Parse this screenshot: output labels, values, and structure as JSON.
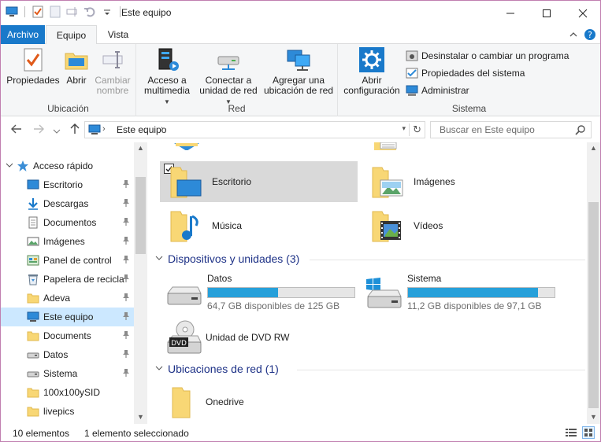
{
  "window": {
    "title": "Este equipo",
    "minimize_glyph": "—",
    "maximize_glyph": "☐",
    "close_glyph": "✕"
  },
  "tabs": {
    "file": "Archivo",
    "computer": "Equipo",
    "view": "Vista"
  },
  "ribbon": {
    "ubicacion": {
      "label": "Ubicación",
      "propiedades": "Propiedades",
      "abrir": "Abrir",
      "cambiar_1": "Cambiar",
      "cambiar_2": "nombre"
    },
    "red": {
      "label": "Red",
      "acceso_1": "Acceso a",
      "acceso_2": "multimedia",
      "conectar_1": "Conectar a",
      "conectar_2": "unidad de red",
      "agregar_1": "Agregar una",
      "agregar_2": "ubicación de red"
    },
    "sistema": {
      "label": "Sistema",
      "abrir_1": "Abrir",
      "abrir_2": "configuración",
      "desinstalar": "Desinstalar o cambiar un programa",
      "propiedades": "Propiedades del sistema",
      "administrar": "Administrar"
    }
  },
  "address": {
    "path": "Este equipo",
    "search_placeholder": "Buscar en Este equipo"
  },
  "sidebar": {
    "quick_access": "Acceso rápido",
    "items": [
      {
        "label": "Escritorio",
        "icon": "desktop-icon",
        "pinned": true
      },
      {
        "label": "Descargas",
        "icon": "download-icon",
        "pinned": true
      },
      {
        "label": "Documentos",
        "icon": "document-icon",
        "pinned": true
      },
      {
        "label": "Imágenes",
        "icon": "pictures-icon",
        "pinned": true
      },
      {
        "label": "Panel de control",
        "icon": "control-panel-icon",
        "pinned": true
      },
      {
        "label": "Papelera de recicla",
        "icon": "recycle-bin-icon",
        "pinned": true
      },
      {
        "label": "Adeva",
        "icon": "folder-icon",
        "pinned": true
      },
      {
        "label": "Este equipo",
        "icon": "computer-icon",
        "pinned": true,
        "selected": true
      },
      {
        "label": "Documents",
        "icon": "folder-icon",
        "pinned": true
      },
      {
        "label": "Datos",
        "icon": "drive-icon",
        "pinned": true
      },
      {
        "label": "Sistema",
        "icon": "drive-icon",
        "pinned": true
      },
      {
        "label": "100x100ySID",
        "icon": "folder-icon",
        "pinned": false
      },
      {
        "label": "livepics",
        "icon": "folder-icon",
        "pinned": false
      }
    ]
  },
  "content": {
    "folders": [
      {
        "label": "Escritorio",
        "icon": "desktop-folder-icon",
        "selected": true
      },
      {
        "label": "Imágenes",
        "icon": "pictures-folder-icon"
      },
      {
        "label": "Música",
        "icon": "music-folder-icon"
      },
      {
        "label": "Vídeos",
        "icon": "videos-folder-icon"
      }
    ],
    "devices_header": "Dispositivos y unidades (3)",
    "drives": [
      {
        "name": "Datos",
        "free": "64,7 GB disponibles de 125 GB",
        "used_fraction": 0.48
      },
      {
        "name": "Sistema",
        "free": "11,2 GB disponibles de 97,1 GB",
        "used_fraction": 0.885
      }
    ],
    "dvd": "Unidad de DVD RW",
    "dvd_badge": "DVD",
    "network_header": "Ubicaciones de red (1)",
    "network": [
      {
        "label": "Onedrive"
      }
    ]
  },
  "status": {
    "count": "10 elementos",
    "selection": "1 elemento seleccionado"
  },
  "colors": {
    "accent": "#1979ca",
    "drive_fill": "#26a0da",
    "selected_bg": "#cce8ff",
    "folder": "#f8d775"
  }
}
